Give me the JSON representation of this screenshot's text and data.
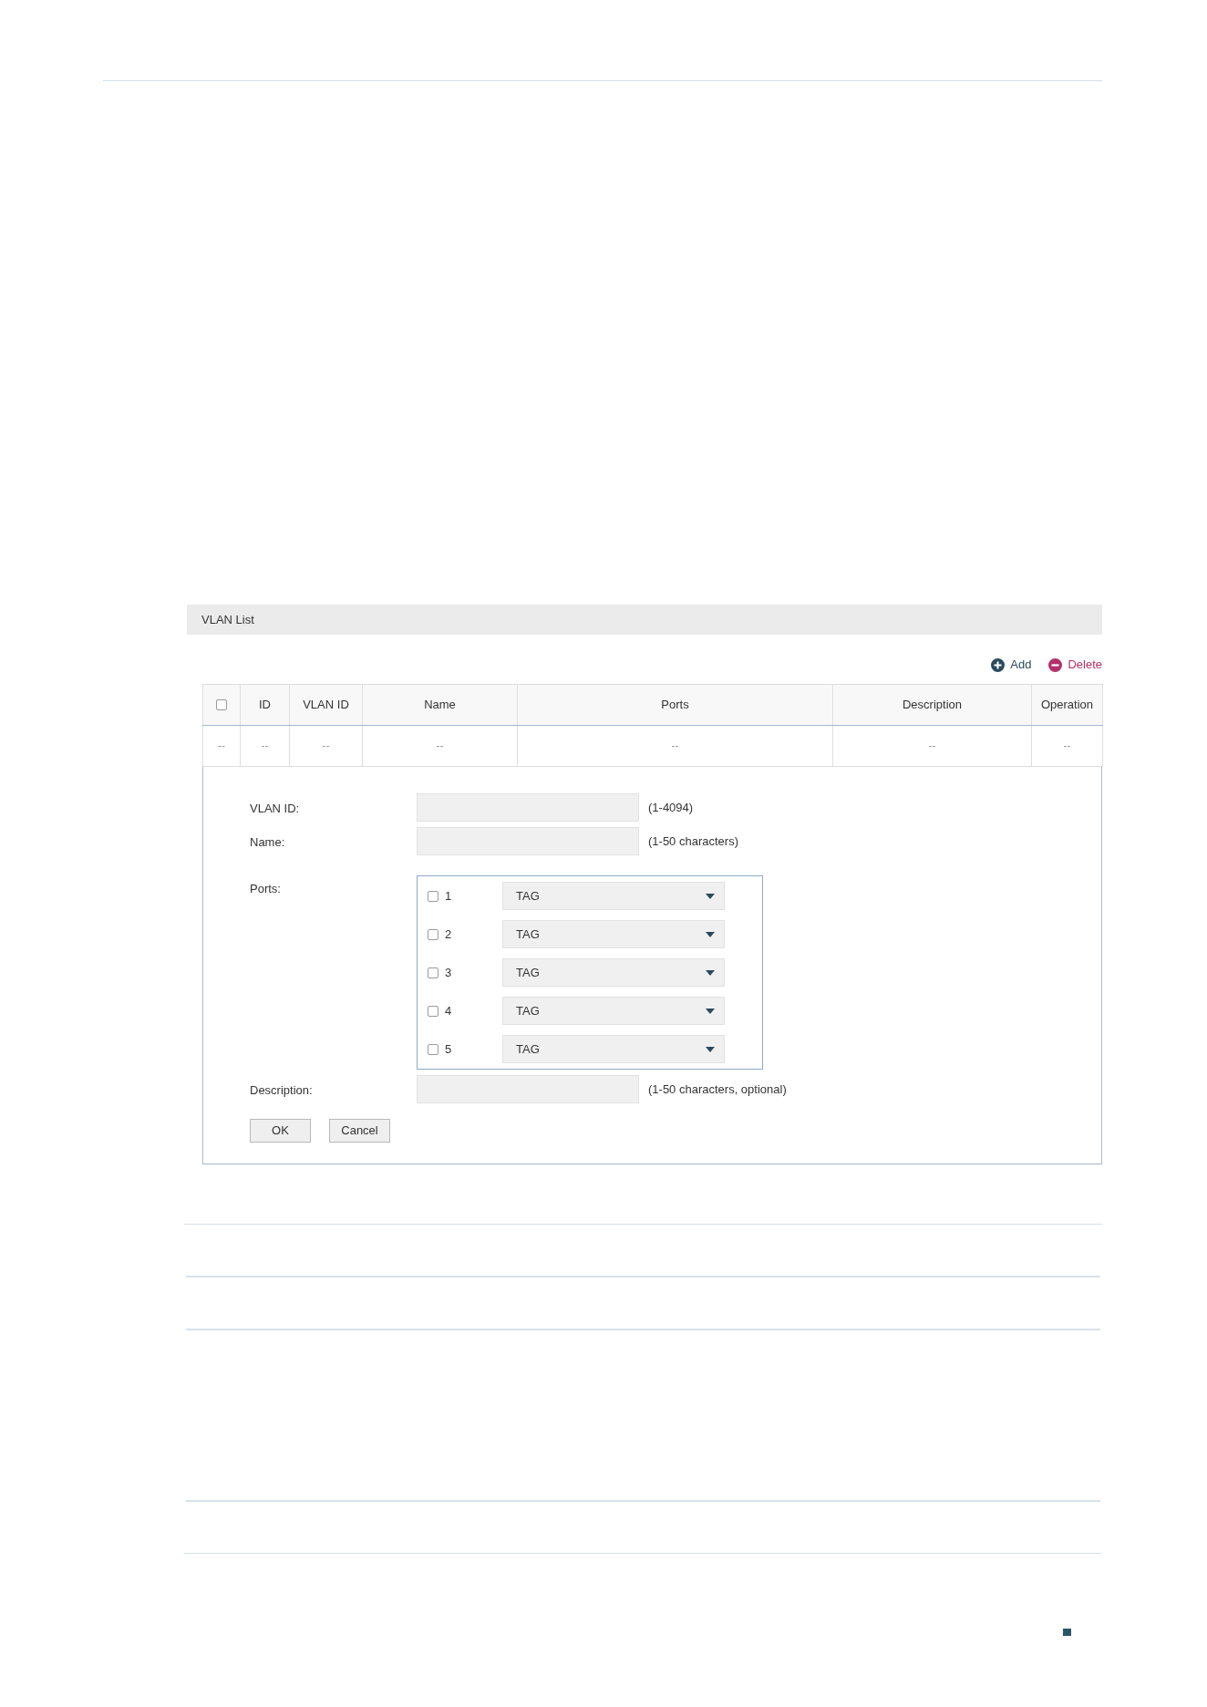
{
  "panel": {
    "title": "VLAN List"
  },
  "toolbar": [
    {
      "kind": "add",
      "label": "Add"
    },
    {
      "kind": "delete",
      "label": "Delete"
    }
  ],
  "table": {
    "columns": [
      {
        "kind": "checkbox",
        "checked": false
      },
      {
        "kind": "text",
        "label": "ID"
      },
      {
        "kind": "text",
        "label": "VLAN ID"
      },
      {
        "kind": "text",
        "label": "Name"
      },
      {
        "kind": "text",
        "label": "Ports"
      },
      {
        "kind": "text",
        "label": "Description"
      },
      {
        "kind": "text",
        "label": "Operation"
      }
    ],
    "rows": [
      {
        "cells": [
          "--",
          "--",
          "--",
          "--",
          "--",
          "--",
          "--"
        ]
      }
    ]
  },
  "form": {
    "rows": [
      {
        "kind": "text",
        "label": "VLAN ID:",
        "hint": "(1-4094)"
      },
      {
        "kind": "text",
        "label": "Name:",
        "hint": "(1-50 characters)"
      },
      {
        "kind": "ports",
        "label": "Ports:",
        "ports": [
          {
            "number": "1",
            "checked": false,
            "mode": "TAG"
          },
          {
            "number": "2",
            "checked": false,
            "mode": "TAG"
          },
          {
            "number": "3",
            "checked": false,
            "mode": "TAG"
          },
          {
            "number": "4",
            "checked": false,
            "mode": "TAG"
          },
          {
            "number": "5",
            "checked": false,
            "mode": "TAG"
          }
        ]
      },
      {
        "kind": "text",
        "label": "Description:",
        "hint": "(1-50 characters, optional)"
      }
    ],
    "buttons": [
      "OK",
      "Cancel"
    ]
  }
}
